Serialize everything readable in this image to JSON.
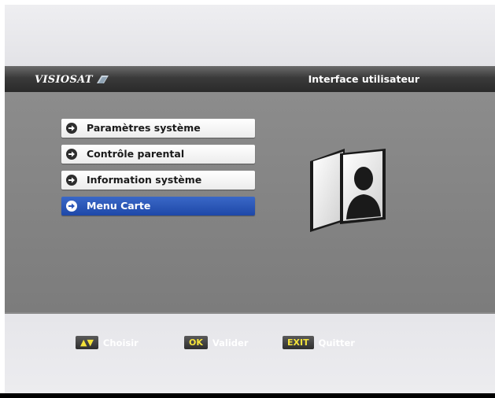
{
  "header": {
    "logo_text": "VISIOSAT",
    "title": "Interface utilisateur"
  },
  "menu": {
    "items": [
      {
        "label": "Paramètres système",
        "selected": false
      },
      {
        "label": "Contrôle parental",
        "selected": false
      },
      {
        "label": "Information système",
        "selected": false
      },
      {
        "label": "Menu Carte",
        "selected": true
      }
    ]
  },
  "footer": {
    "keys": [
      {
        "key_label": "▲▼",
        "action": "Choisir"
      },
      {
        "key_label": "OK",
        "action": "Valider"
      },
      {
        "key_label": "EXIT",
        "action": "Quitter"
      }
    ]
  },
  "colors": {
    "highlight": "#2a55b8",
    "key_text": "#f4e23a"
  },
  "icons": {
    "menu_item": "arrow-right-circle-icon",
    "illustration": "user-profile-icon"
  }
}
